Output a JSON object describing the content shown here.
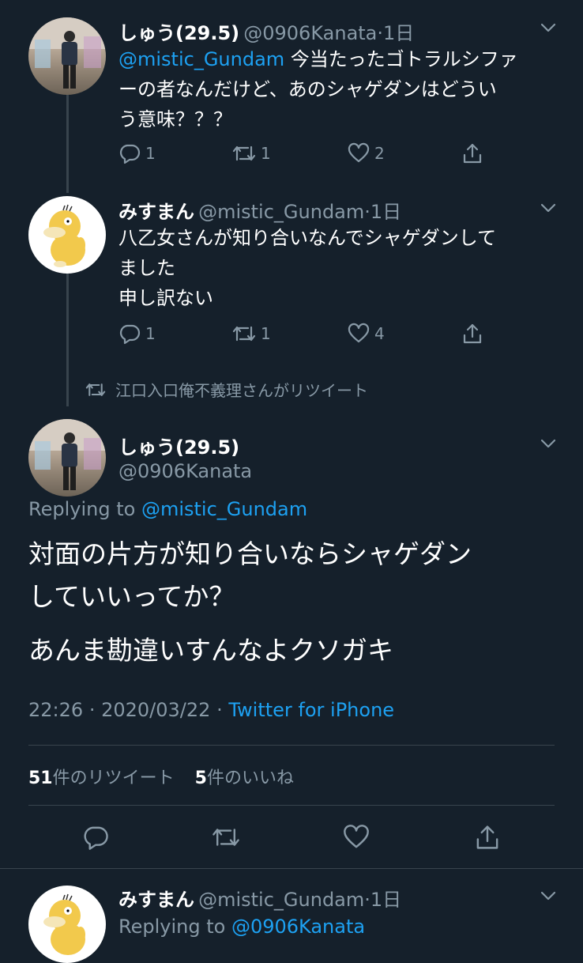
{
  "tweet1": {
    "name": "しゅう(29.5)",
    "handle": "@0906Kanata",
    "sep": "·",
    "time": "1日",
    "mention": "@mistic_Gundam",
    "text_line1": " 今当たったゴトラルシファ",
    "text_line2": "ーの者なんだけど、あのシャゲダンはどうい",
    "text_line3": "う意味？？？",
    "reply_count": "1",
    "retweet_count": "1",
    "like_count": "2"
  },
  "tweet2": {
    "name": "みすまん",
    "handle": "@mistic_Gundam",
    "sep": "·",
    "time": "1日",
    "text_line1": "八乙女さんが知り合いなんでシャゲダンして",
    "text_line2": "ました",
    "text_line3": "申し訳ない",
    "reply_count": "1",
    "retweet_count": "1",
    "like_count": "4"
  },
  "retweet_notice": "江口入口俺不義理さんがリツイート",
  "main_tweet": {
    "name": "しゅう(29.5)",
    "handle": "@0906Kanata",
    "replying_prefix": "Replying to ",
    "replying_to": "@mistic_Gundam",
    "text_line1": "対面の片方が知り合いならシャゲダン",
    "text_line2": "していいってか？",
    "text_line3": "あんま勘違いすんなよクソガキ",
    "time": "22:26",
    "date": "2020/03/22",
    "sep1": "·",
    "sep2": "·",
    "source": "Twitter for iPhone",
    "retweets_count": "51",
    "retweets_label": "件のリツイート",
    "likes_count": "5",
    "likes_label": "件のいいね"
  },
  "tweet4": {
    "name": "みすまん",
    "handle": "@mistic_Gundam",
    "sep": "·",
    "time": "1日",
    "replying_prefix": "Replying to ",
    "replying_to": "@0906Kanata"
  },
  "colors": {
    "background": "#15202b",
    "link": "#1da1f2",
    "secondary_text": "#8899a6",
    "divider": "#38444d"
  },
  "icons": [
    "reply-icon",
    "retweet-icon",
    "like-icon",
    "share-icon",
    "chevron-down-icon",
    "avatar-photo",
    "avatar-psyduck"
  ]
}
